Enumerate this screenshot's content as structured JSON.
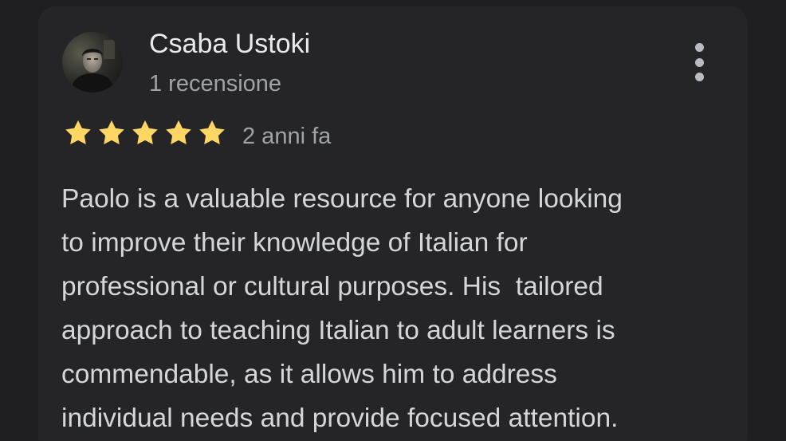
{
  "review": {
    "author": "Csaba Ustoki",
    "review_count": "1 recensione",
    "rating": 5,
    "rating_max": 5,
    "time_ago": "2 anni fa",
    "text_lines": [
      "Paolo is a valuable resource for anyone looking",
      "to improve their knowledge of Italian for",
      "professional or cultural purposes. His  tailored",
      "approach to teaching Italian to adult learners is",
      "commendable, as it allows him to address",
      "individual needs and provide focused attention."
    ]
  },
  "icons": {
    "avatar": "user-avatar-photo",
    "more": "more-vert-icon",
    "star": "star-icon"
  },
  "colors": {
    "background": "#1f1f21",
    "card": "#252527",
    "star": "#fdd663",
    "primary_text": "#e8eaed",
    "secondary_text": "#a0a3a8",
    "body_text": "#d4d6da"
  }
}
